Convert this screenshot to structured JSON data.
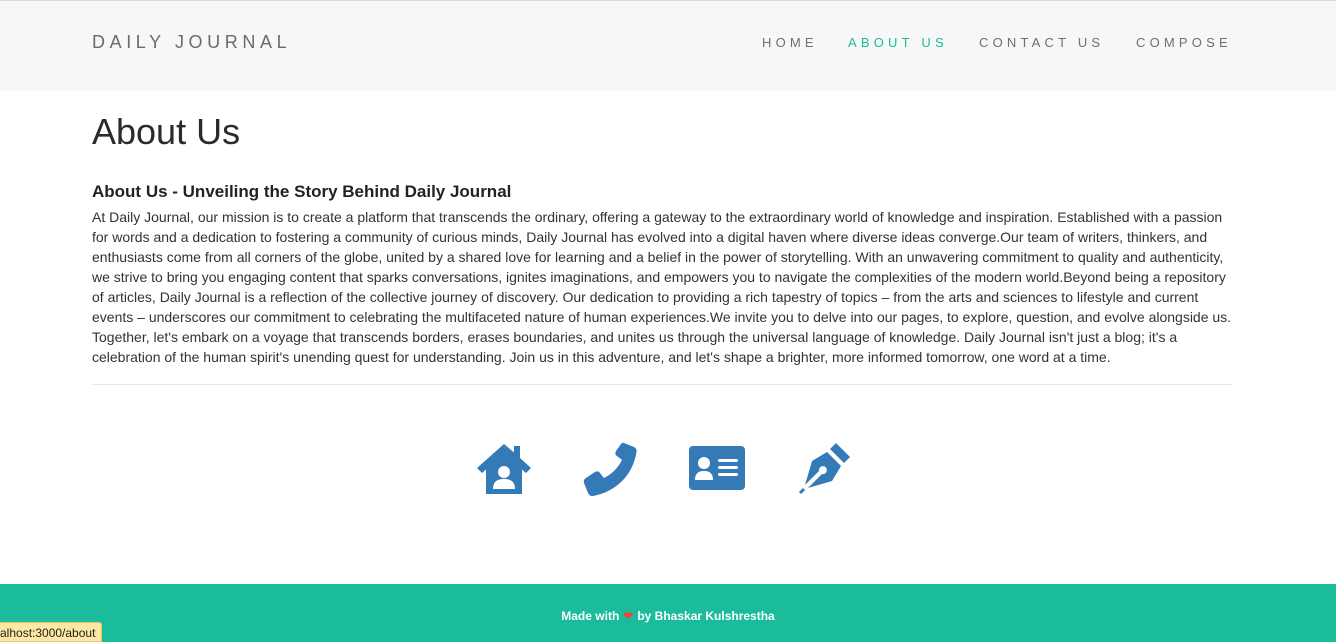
{
  "navbar": {
    "brand": "DAILY JOURNAL",
    "links": [
      {
        "label": "HOME",
        "icon": null
      },
      {
        "label": "ABOUT US",
        "active": true
      },
      {
        "label": "CONTACT US"
      },
      {
        "label": "COMPOSE"
      }
    ]
  },
  "main": {
    "title": "About Us",
    "section_title": "About Us - Unveiling the Story Behind Daily Journal",
    "body": "At Daily Journal, our mission is to create a platform that transcends the ordinary, offering a gateway to the extraordinary world of knowledge and inspiration. Established with a passion for words and a dedication to fostering a community of curious minds, Daily Journal has evolved into a digital haven where diverse ideas converge.Our team of writers, thinkers, and enthusiasts come from all corners of the globe, united by a shared love for learning and a belief in the power of storytelling. With an unwavering commitment to quality and authenticity, we strive to bring you engaging content that sparks conversations, ignites imaginations, and empowers you to navigate the complexities of the modern world.Beyond being a repository of articles, Daily Journal is a reflection of the collective journey of discovery. Our dedication to providing a rich tapestry of topics – from the arts and sciences to lifestyle and current events – underscores our commitment to celebrating the multifaceted nature of human experiences.We invite you to delve into our pages, to explore, question, and evolve alongside us. Together, let's embark on a voyage that transcends borders, erases boundaries, and unites us through the universal language of knowledge. Daily Journal isn't just a blog; it's a celebration of the human spirit's unending quest for understanding. Join us in this adventure, and let's shape a brighter, more informed tomorrow, one word at a time."
  },
  "icons": [
    {
      "name": "house-user-icon"
    },
    {
      "name": "phone-icon"
    },
    {
      "name": "address-card-icon"
    },
    {
      "name": "pen-nib-icon"
    }
  ],
  "footer": {
    "made_with": "Made with",
    "by": "by Bhaskar Kulshrestha"
  },
  "status_bar": {
    "url": "alhost:3000/about"
  },
  "colors": {
    "accent": "#1abc9c",
    "icon_blue": "#337ab7",
    "navbar_bg": "#f7f7f7"
  }
}
